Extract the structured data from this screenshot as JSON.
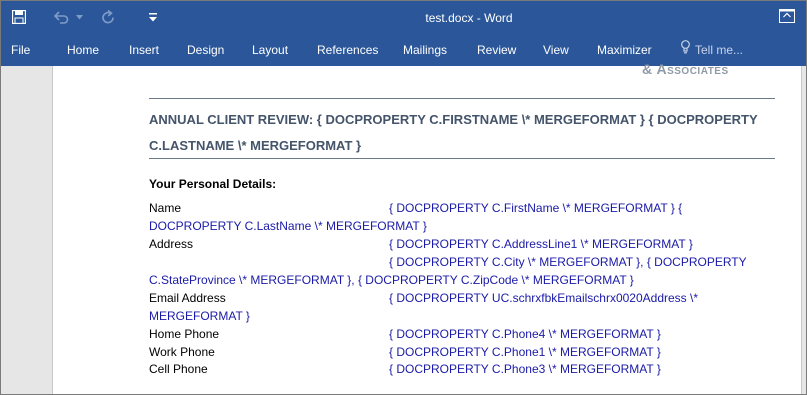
{
  "window": {
    "title": "test.docx - Word",
    "qat_custom_glyph": "≡",
    "restore_icon": "ribbon-display-options-icon"
  },
  "ribbon": {
    "tabs": [
      "File",
      "Home",
      "Insert",
      "Design",
      "Layout",
      "References",
      "Mailings",
      "Review",
      "View",
      "Maximizer"
    ],
    "tell_me": "Tell me..."
  },
  "document": {
    "logo_fragment": "& Associates",
    "heading_line1": "ANNUAL CLIENT REVIEW: { DOCPROPERTY C.FIRSTNAME \\* MERGEFORMAT } { DOCPROPERTY",
    "heading_line2": "C.LASTNAME \\* MERGEFORMAT }",
    "section_title": "Your Personal Details:",
    "rows": {
      "name_label": "Name",
      "name_field_1": "{ DOCPROPERTY C.FirstName \\* MERGEFORMAT } {",
      "name_field_2": "DOCPROPERTY C.LastName \\* MERGEFORMAT }",
      "address_label": "Address",
      "address_field_1": "{ DOCPROPERTY C.AddressLine1 \\* MERGEFORMAT }",
      "address_field_2": "{ DOCPROPERTY C.City \\* MERGEFORMAT }, { DOCPROPERTY",
      "address_field_3": "C.StateProvince \\* MERGEFORMAT }, { DOCPROPERTY C.ZipCode \\* MERGEFORMAT }",
      "email_label": "Email Address",
      "email_field_1": "{ DOCPROPERTY UC.schrxfbkEmailschrx0020Address \\*",
      "email_field_2": "MERGEFORMAT }",
      "home_label": "Home Phone",
      "home_field": "{ DOCPROPERTY C.Phone4 \\* MERGEFORMAT }",
      "work_label": "Work Phone",
      "work_field": "{ DOCPROPERTY C.Phone1 \\* MERGEFORMAT }",
      "cell_label": "Cell Phone",
      "cell_field": "{ DOCPROPERTY C.Phone3 \\* MERGEFORMAT }"
    }
  },
  "colors": {
    "ribbon_blue": "#2b579a",
    "heading_slate": "#44546a",
    "field_code_blue": "#1a1aa8"
  }
}
